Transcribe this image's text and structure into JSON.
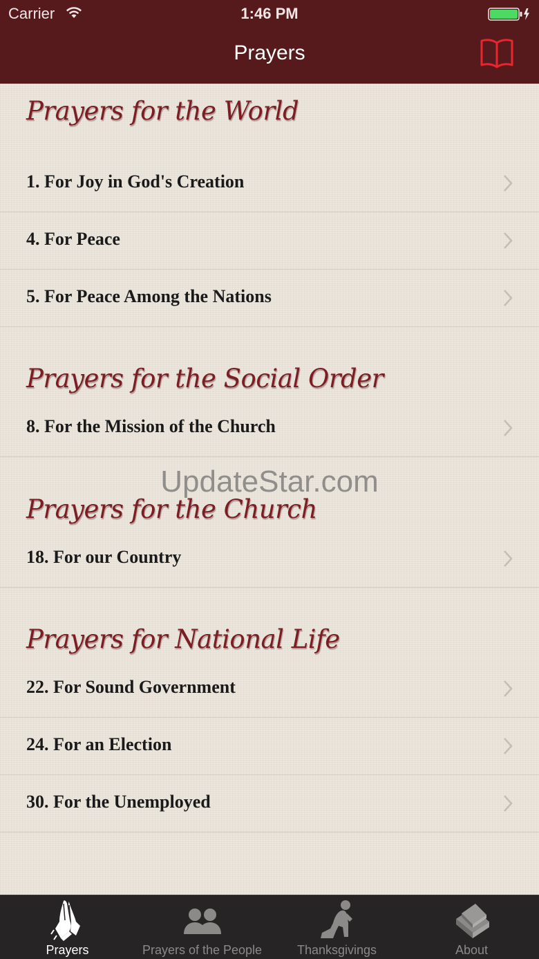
{
  "status_bar": {
    "carrier": "Carrier",
    "time": "1:46 PM",
    "battery_color": "#4cd964"
  },
  "nav": {
    "title": "Prayers",
    "right_icon": "book-icon",
    "accent": "#e8262d"
  },
  "sections": [
    {
      "title": "Prayers for the World",
      "items": [
        "1. For Joy in God's Creation",
        "4. For Peace",
        "5. For Peace Among the Nations"
      ]
    },
    {
      "title": "Prayers for the Social Order",
      "items": [
        "8. For the Mission of the Church"
      ]
    },
    {
      "title": "Prayers for the Church",
      "items": [
        "18. For our Country"
      ]
    },
    {
      "title": "Prayers for National Life",
      "items": [
        "22. For Sound Government",
        "24. For an Election",
        "30. For the Unemployed"
      ]
    }
  ],
  "watermark": "UpdateStar.com",
  "tabs": [
    {
      "label": "Prayers",
      "icon": "praying-hands-icon",
      "active": true
    },
    {
      "label": "Prayers of the People",
      "icon": "people-icon",
      "active": false
    },
    {
      "label": "Thanksgivings",
      "icon": "kneeling-figure-icon",
      "active": false
    },
    {
      "label": "About",
      "icon": "book-stack-icon",
      "active": false
    }
  ],
  "colors": {
    "nav_bar": "#561a1d",
    "section_header": "#7b1d23",
    "tab_bar": "#262424"
  }
}
